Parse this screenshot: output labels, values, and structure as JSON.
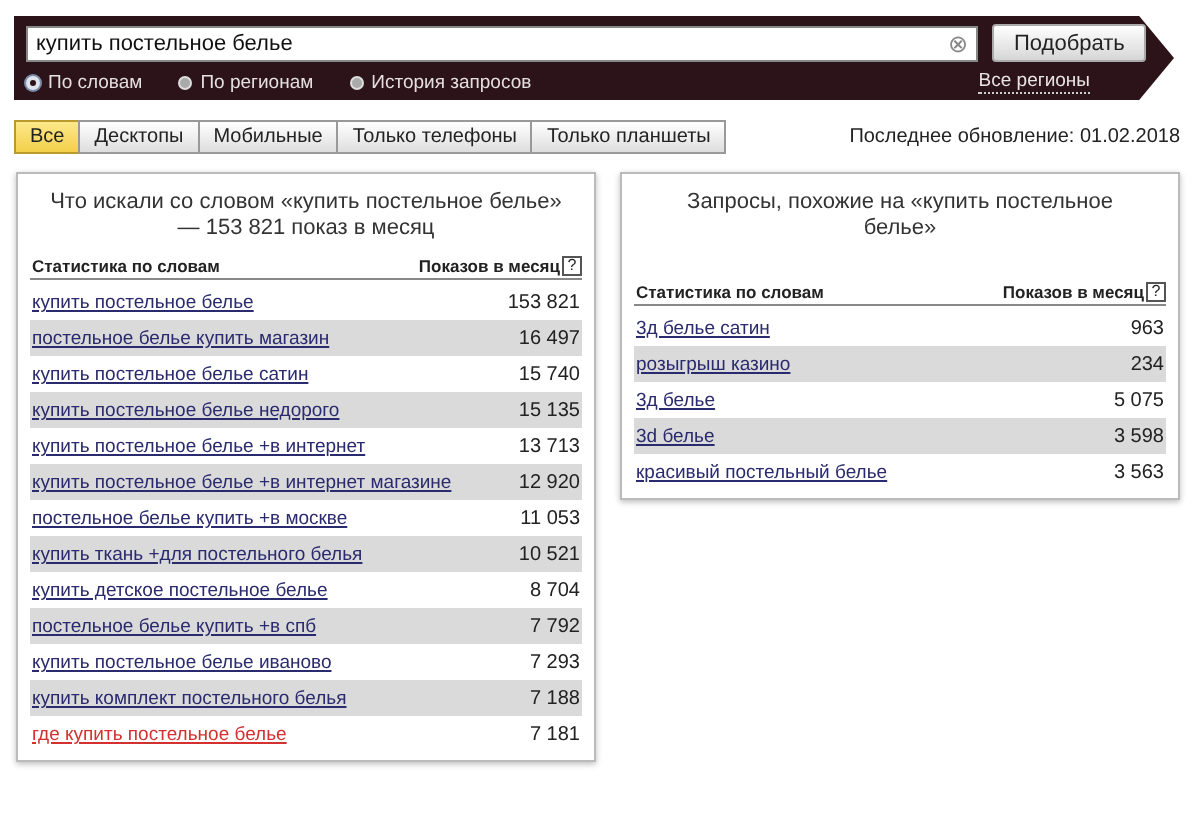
{
  "search": {
    "value": "купить постельное белье",
    "button": "Подобрать",
    "clear": "⊗"
  },
  "modes": [
    {
      "label": "По словам",
      "selected": true
    },
    {
      "label": "По регионам",
      "selected": false
    },
    {
      "label": "История запросов",
      "selected": false
    }
  ],
  "region_link": "Все регионы",
  "tabs": [
    {
      "label": "Все",
      "selected": true
    },
    {
      "label": "Десктопы",
      "selected": false
    },
    {
      "label": "Мобильные",
      "selected": false
    },
    {
      "label": "Только телефоны",
      "selected": false
    },
    {
      "label": "Только планшеты",
      "selected": false
    }
  ],
  "last_update": "Последнее обновление: 01.02.2018",
  "panels": [
    {
      "title": "Что искали со словом «купить постельное белье» — 153 821 показ в месяц",
      "columns": [
        "Статистика по словам",
        "Показов в месяц"
      ],
      "help": "?",
      "rows": [
        {
          "phrase": "купить постельное белье",
          "count": "153 821",
          "highlighted": false
        },
        {
          "phrase": "постельное белье купить магазин",
          "count": "16 497",
          "highlighted": false
        },
        {
          "phrase": "купить постельное белье сатин",
          "count": "15 740",
          "highlighted": false
        },
        {
          "phrase": "купить постельное белье недорого",
          "count": "15 135",
          "highlighted": false
        },
        {
          "phrase": "купить постельное белье +в интернет",
          "count": "13 713",
          "highlighted": false
        },
        {
          "phrase": "купить постельное белье +в интернет магазине",
          "count": "12 920",
          "highlighted": false
        },
        {
          "phrase": "постельное белье купить +в москве",
          "count": "11 053",
          "highlighted": false
        },
        {
          "phrase": "купить ткань +для постельного белья",
          "count": "10 521",
          "highlighted": false
        },
        {
          "phrase": "купить детское постельное белье",
          "count": "8 704",
          "highlighted": false
        },
        {
          "phrase": "постельное белье купить +в спб",
          "count": "7 792",
          "highlighted": false
        },
        {
          "phrase": "купить постельное белье иваново",
          "count": "7 293",
          "highlighted": false
        },
        {
          "phrase": "купить комплект постельного белья",
          "count": "7 188",
          "highlighted": false
        },
        {
          "phrase": "где купить постельное белье",
          "count": "7 181",
          "highlighted": true
        }
      ]
    },
    {
      "title": "Запросы, похожие на «купить постельное белье»",
      "columns": [
        "Статистика по словам",
        "Показов в месяц"
      ],
      "help": "?",
      "rows": [
        {
          "phrase": "3д белье сатин",
          "count": "963",
          "highlighted": false
        },
        {
          "phrase": "розыгрыш казино",
          "count": "234",
          "highlighted": false
        },
        {
          "phrase": "3д белье",
          "count": "5 075",
          "highlighted": false
        },
        {
          "phrase": "3d белье",
          "count": "3 598",
          "highlighted": false
        },
        {
          "phrase": "красивый постельный белье",
          "count": "3 563",
          "highlighted": false
        }
      ]
    }
  ]
}
